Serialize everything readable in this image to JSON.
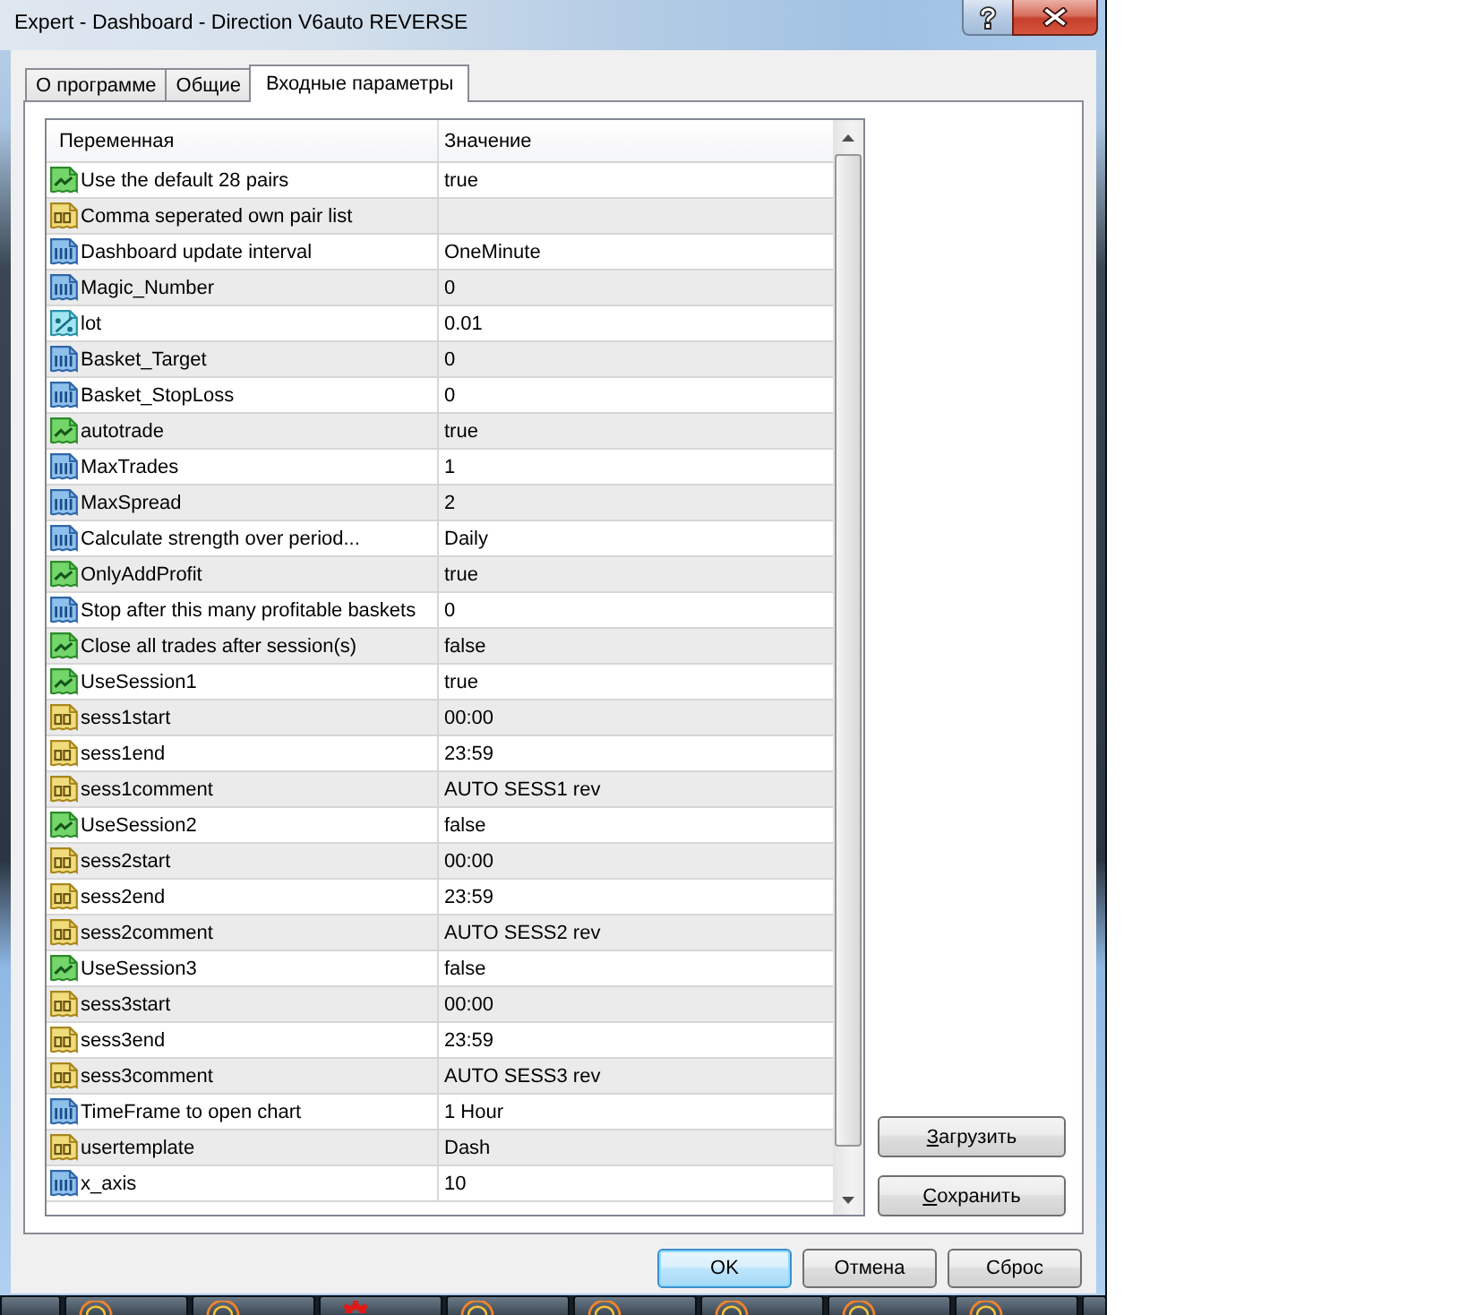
{
  "window": {
    "title": "Expert - Dashboard - Direction V6auto REVERSE"
  },
  "tabs": [
    {
      "label": "О программе",
      "selected": false
    },
    {
      "label": "Общие",
      "selected": false
    },
    {
      "label": "Входные параметры",
      "selected": true
    }
  ],
  "table": {
    "columns": [
      "Переменная",
      "Значение"
    ],
    "rows": [
      {
        "kind": "bool",
        "name": "Use the default 28 pairs",
        "value": "true"
      },
      {
        "kind": "string",
        "name": "Comma seperated own pair list"
      },
      {
        "kind": "int",
        "name": "Dashboard update interval",
        "value": "OneMinute"
      },
      {
        "kind": "int",
        "name": "Magic_Number",
        "value": "0"
      },
      {
        "kind": "double",
        "name": "lot",
        "value": "0.01"
      },
      {
        "kind": "int",
        "name": "Basket_Target",
        "value": "0"
      },
      {
        "kind": "int",
        "name": "Basket_StopLoss",
        "value": "0"
      },
      {
        "kind": "bool",
        "name": "autotrade",
        "value": "true"
      },
      {
        "kind": "int",
        "name": "MaxTrades",
        "value": "1"
      },
      {
        "kind": "int",
        "name": "MaxSpread",
        "value": "2"
      },
      {
        "kind": "int",
        "name": "Calculate strength over period...",
        "value": "Daily"
      },
      {
        "kind": "bool",
        "name": "OnlyAddProfit",
        "value": "true"
      },
      {
        "kind": "int",
        "name": "Stop after this many profitable baskets",
        "value": "0"
      },
      {
        "kind": "bool",
        "name": "Close all trades after session(s)",
        "value": "false"
      },
      {
        "kind": "bool",
        "name": "UseSession1",
        "value": "true"
      },
      {
        "kind": "string",
        "name": "sess1start",
        "value": "00:00"
      },
      {
        "kind": "string",
        "name": "sess1end",
        "value": "23:59"
      },
      {
        "kind": "string",
        "name": "sess1comment",
        "value": "AUTO SESS1 rev"
      },
      {
        "kind": "bool",
        "name": "UseSession2",
        "value": "false"
      },
      {
        "kind": "string",
        "name": "sess2start",
        "value": "00:00"
      },
      {
        "kind": "string",
        "name": "sess2end",
        "value": "23:59"
      },
      {
        "kind": "string",
        "name": "sess2comment",
        "value": "AUTO SESS2 rev"
      },
      {
        "kind": "bool",
        "name": "UseSession3",
        "value": "false"
      },
      {
        "kind": "string",
        "name": "sess3start",
        "value": "00:00"
      },
      {
        "kind": "string",
        "name": "sess3end",
        "value": "23:59"
      },
      {
        "kind": "string",
        "name": "sess3comment",
        "value": "AUTO SESS3 rev"
      },
      {
        "kind": "int",
        "name": "TimeFrame to open chart",
        "value": "1 Hour"
      },
      {
        "kind": "string",
        "name": "usertemplate",
        "value": "Dash"
      },
      {
        "kind": "int",
        "name": "x_axis",
        "value": "10"
      }
    ]
  },
  "side_buttons": [
    {
      "label": "Загрузить",
      "mnemonic": true
    },
    {
      "label": "Сохранить",
      "mnemonic": true
    }
  ],
  "dialog_buttons": [
    {
      "label": "OK",
      "default": true
    },
    {
      "label": "Отмена",
      "default": false
    },
    {
      "label": "Сброс",
      "default": false
    }
  ],
  "taskbar": {
    "tabs": [
      {
        "kind": "blank"
      },
      {
        "kind": "arc"
      },
      {
        "kind": "arc"
      },
      {
        "kind": "gear"
      },
      {
        "kind": "arc"
      },
      {
        "kind": "arc"
      },
      {
        "kind": "arc"
      },
      {
        "kind": "arc"
      },
      {
        "kind": "arc"
      },
      {
        "kind": "blank"
      }
    ]
  }
}
